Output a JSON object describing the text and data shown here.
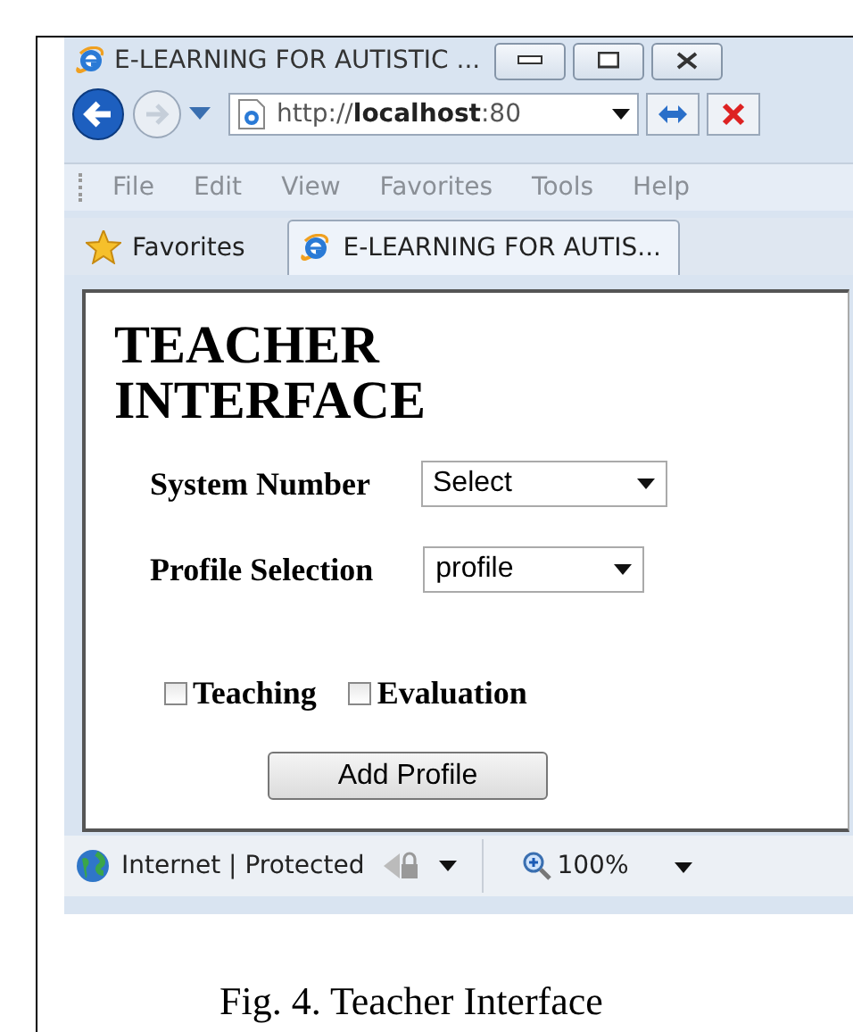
{
  "window": {
    "title": "E-LEARNING FOR AUTISTIC ...",
    "address": "http://**localhost**:80"
  },
  "menu": [
    "File",
    "Edit",
    "View",
    "Favorites",
    "Tools",
    "Help"
  ],
  "favorites": {
    "label": "Favorites"
  },
  "tabs": [
    {
      "label": "E-LEARNING FOR AUTIS...",
      "selected": true
    }
  ],
  "page": {
    "heading": "TEACHER INTERFACE",
    "fields": [
      {
        "label": "System Number",
        "value": "Select"
      },
      {
        "label": "Profile Selection",
        "value": "profile"
      }
    ],
    "checkboxes": [
      {
        "label": "Teaching",
        "checked": false
      },
      {
        "label": "Evaluation",
        "checked": false
      }
    ],
    "button": "Add Profile"
  },
  "status_bar": {
    "zone": "Internet | Protected",
    "zoom": "100%"
  },
  "caption": "Fig. 4. Teacher Interface"
}
